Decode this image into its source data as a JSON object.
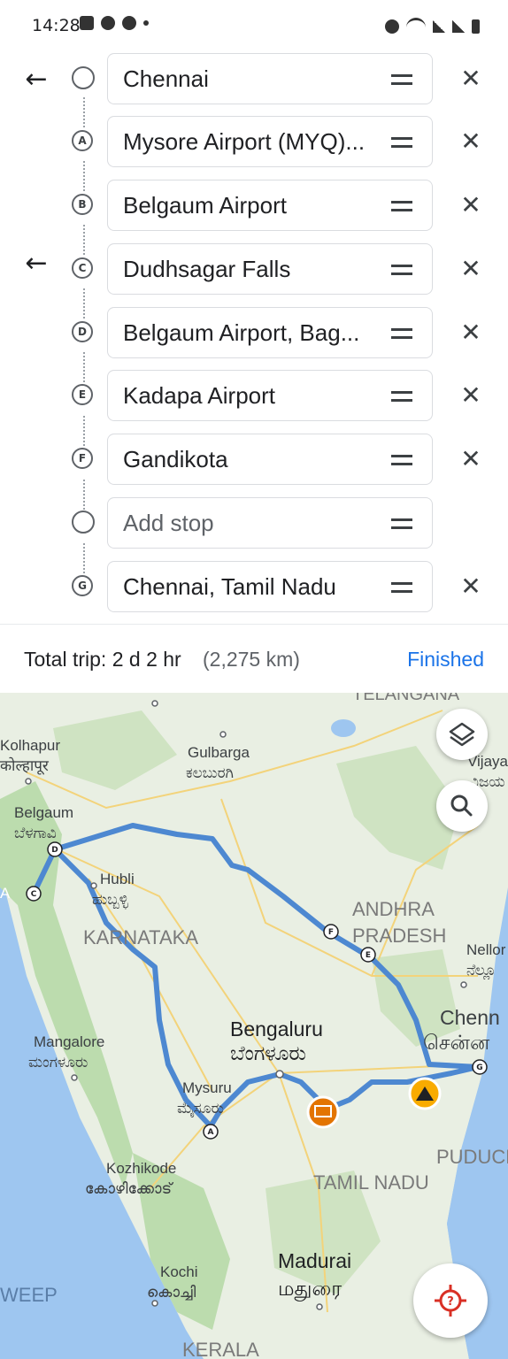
{
  "status_bar": {
    "time": "14:28"
  },
  "stops": [
    {
      "marker": "",
      "label": "Chennai",
      "placeholder": false,
      "removable": true
    },
    {
      "marker": "A",
      "label": "Mysore Airport (MYQ)...",
      "placeholder": false,
      "removable": true
    },
    {
      "marker": "B",
      "label": "Belgaum Airport",
      "placeholder": false,
      "removable": true
    },
    {
      "marker": "C",
      "label": "Dudhsagar Falls",
      "placeholder": false,
      "removable": true
    },
    {
      "marker": "D",
      "label": "Belgaum Airport, Bag...",
      "placeholder": false,
      "removable": true
    },
    {
      "marker": "E",
      "label": "Kadapa Airport",
      "placeholder": false,
      "removable": true
    },
    {
      "marker": "F",
      "label": "Gandikota",
      "placeholder": false,
      "removable": true
    },
    {
      "marker": "",
      "label": "Add stop",
      "placeholder": true,
      "removable": false
    },
    {
      "marker": "G",
      "label": "Chennai, Tamil Nadu",
      "placeholder": false,
      "removable": true
    }
  ],
  "summary": {
    "total": "Total trip: 2 d 2 hr",
    "distance": "(2,275 km)",
    "finished": "Finished"
  },
  "map": {
    "labels": {
      "kolhapur": "Kolhapur",
      "kolhapur_local": "कोल्हापूर",
      "gulbarga": "Gulbarga",
      "gulbarga_local": "ಕಲಬುರಗಿ",
      "belgaum": "Belgaum",
      "belgaum_local": "ಬೆಳಗಾವಿ",
      "hubli": "Hubli",
      "hubli_local": "ಹುಬ್ಬಳ್ಳಿ",
      "karnataka": "KARNATAKA",
      "andhra": "ANDHRA",
      "pradesh": "PRADESH",
      "nellore": "Nellor",
      "nellore_local": "ನೆಲ್ಲೂ",
      "chennai": "Chenn",
      "chennai_local": "சென்ன",
      "bengaluru": "Bengaluru",
      "bengaluru_local": "ಬೆಂಗಳೂರು",
      "mangalore": "Mangalore",
      "mangalore_local": "ಮಂಗಳೂರು",
      "mysuru": "Mysuru",
      "mysuru_local": "ಮೈಸೂರು",
      "kozhikode": "Kozhikode",
      "kozhikode_local": "കോഴിക്കോട്",
      "tamil_nadu": "TAMIL NADU",
      "puducherry": "PUDUCH",
      "kochi": "Kochi",
      "kochi_local": "കൊച്ചി",
      "madurai": "Madurai",
      "madurai_local": "மதுரை",
      "lakshadweep": "WEEP",
      "kerala": "KERALA",
      "telangana": "TELANGANA",
      "vijayawada": "Vijayа",
      "vijayawada_local": "ವಿಜಯ",
      "goa": "A"
    },
    "colors": {
      "route": "#4d88d1",
      "land": "#e9efe3",
      "forest": "#bcdcae",
      "water": "#9ec6f0",
      "accent": "#1a73e8"
    }
  }
}
